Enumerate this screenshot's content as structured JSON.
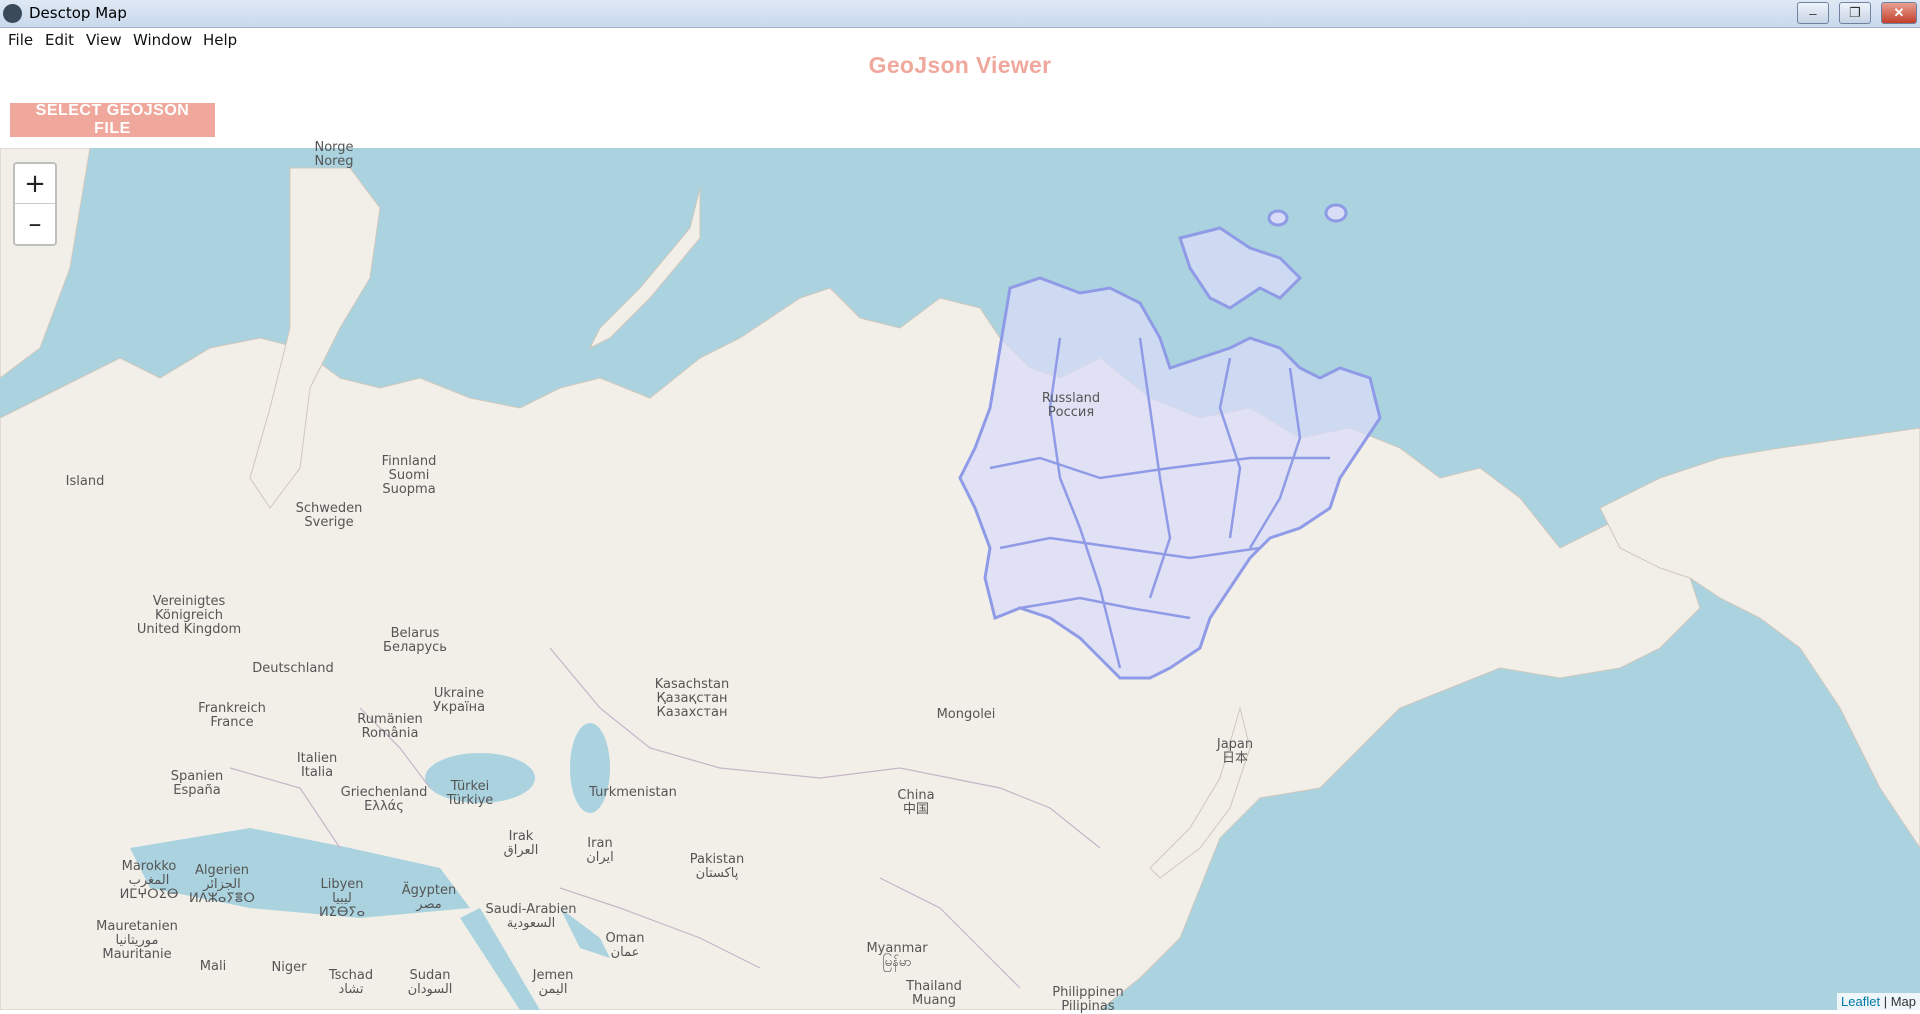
{
  "window": {
    "title": "Desctop Map",
    "minimize": "–",
    "restore": "❐",
    "close": "✕"
  },
  "menu": [
    "File",
    "Edit",
    "View",
    "Window",
    "Help"
  ],
  "header": {
    "title": "GeoJson Viewer",
    "select_button": "SELECT GEOJSON FILE"
  },
  "zoom": {
    "in": "+",
    "out": "–"
  },
  "labels": [
    {
      "lines": [
        "Norge",
        "Noreg"
      ]
    },
    {
      "lines": [
        "Island"
      ]
    },
    {
      "lines": [
        "Finnland",
        "Suomi",
        "Suopma"
      ]
    },
    {
      "lines": [
        "Schweden",
        "Sverige"
      ]
    },
    {
      "lines": [
        "Vereinigtes",
        "Königreich",
        "United Kingdom"
      ]
    },
    {
      "lines": [
        "Belarus",
        "Беларусь"
      ]
    },
    {
      "lines": [
        "Deutschland"
      ]
    },
    {
      "lines": [
        "Ukraine",
        "Україна"
      ]
    },
    {
      "lines": [
        "Frankreich",
        "France"
      ]
    },
    {
      "lines": [
        "Rumänien",
        "România"
      ]
    },
    {
      "lines": [
        "Italien",
        "Italia"
      ]
    },
    {
      "lines": [
        "Spanien",
        "España"
      ]
    },
    {
      "lines": [
        "Griechenland",
        "Ελλάς"
      ]
    },
    {
      "lines": [
        "Türkei",
        "Türkiye"
      ]
    },
    {
      "lines": [
        "Kasachstan",
        "Қазақстан",
        "Казахстан"
      ]
    },
    {
      "lines": [
        "Mongolei"
      ]
    },
    {
      "lines": [
        "Russland",
        "Россия"
      ]
    },
    {
      "lines": [
        "Turkmenistan"
      ]
    },
    {
      "lines": [
        "China",
        "中国"
      ]
    },
    {
      "lines": [
        "Japan",
        "日本"
      ]
    },
    {
      "lines": [
        "Irak",
        "العراق"
      ]
    },
    {
      "lines": [
        "Iran",
        "ایران"
      ]
    },
    {
      "lines": [
        "Pakistan",
        "پاکستان"
      ]
    },
    {
      "lines": [
        "Marokko",
        "المغرب",
        "ⵍⵎⵖⵔⵉⴱ"
      ]
    },
    {
      "lines": [
        "Algerien",
        "الجزائر",
        "ⵍⴷⵣⴰⵢⴻⵔ"
      ]
    },
    {
      "lines": [
        "Libyen",
        "ليبيا",
        "ⵍⵉⴱⵢⴰ"
      ]
    },
    {
      "lines": [
        "Ägypten",
        "مصر"
      ]
    },
    {
      "lines": [
        "Saudi-Arabien",
        "السعودية"
      ]
    },
    {
      "lines": [
        "Oman",
        "عمان"
      ]
    },
    {
      "lines": [
        "Mauretanien",
        "موريتانيا",
        "Mauritanie"
      ]
    },
    {
      "lines": [
        "Mali"
      ]
    },
    {
      "lines": [
        "Niger"
      ]
    },
    {
      "lines": [
        "Tschad",
        "تشاد"
      ]
    },
    {
      "lines": [
        "Sudan",
        "السودان"
      ]
    },
    {
      "lines": [
        "Jemen",
        "اليمن"
      ]
    },
    {
      "lines": [
        "Myanmar",
        "မြန်မာ"
      ]
    },
    {
      "lines": [
        "Thailand",
        "Muang"
      ]
    },
    {
      "lines": [
        "Philippinen",
        "Pilipinas"
      ]
    }
  ],
  "attribution": {
    "link": "Leaflet",
    "sep": " | ",
    "text": "Map"
  },
  "colors": {
    "water": "#aad3df",
    "land": "#f2efe9",
    "accent": "#f0a79c",
    "geojson_stroke": "#8f9be6",
    "geojson_fill": "#d9dcf7"
  }
}
